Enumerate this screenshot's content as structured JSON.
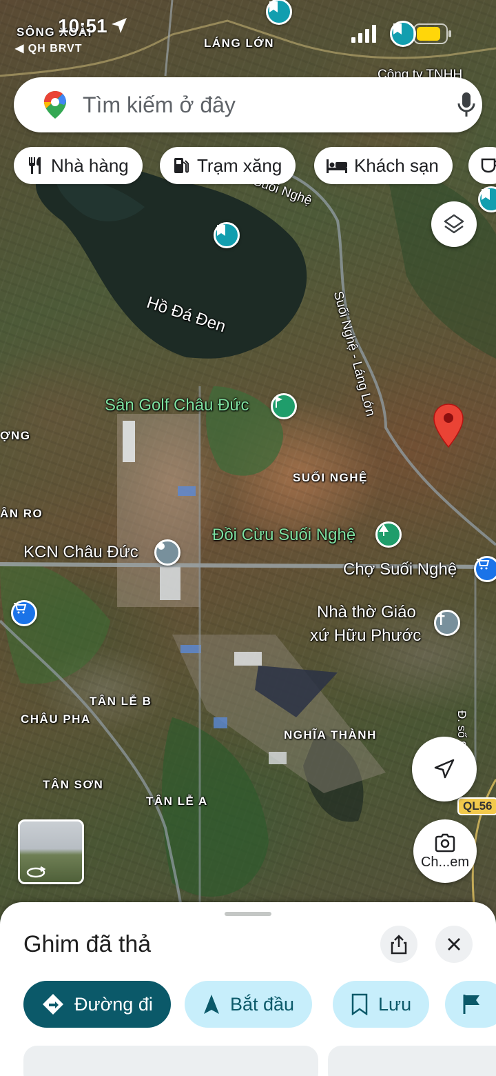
{
  "status_bar": {
    "time": "10:51",
    "back_label": "◀ QH BRVT"
  },
  "search": {
    "placeholder": "Tìm kiếm ở đây"
  },
  "chips": [
    {
      "label": "Nhà hàng",
      "icon": "restaurant-icon"
    },
    {
      "label": "Trạm xăng",
      "icon": "gas-station-icon"
    },
    {
      "label": "Khách sạn",
      "icon": "hotel-icon"
    }
  ],
  "map": {
    "area_labels": {
      "song_xoai": "SÔNG XOÀI",
      "lang_lon": "LÁNG LỚN",
      "cong_ty": "Công ty TNHH",
      "ong": "ỢNG",
      "an_ro": "ÂN RO",
      "suoi_nghe": "SUỐI NGHỆ",
      "tan_le_b": "TÂN LỄ B",
      "chau_pha": "CHÂU PHA",
      "tan_son": "TÂN SƠN",
      "tan_le_a": "TÂN LỄ A",
      "nghia_thanh": "NGHĨA THÀNH"
    },
    "road_labels": {
      "suoi_nghe_lang_lon": "Suối Nghệ - Láng Lớn",
      "suoi_nghe_top": "Suối Nghệ",
      "ql56": "QL56",
      "road_9": "Đ. số 9"
    },
    "pois": {
      "ho_da_den": "Hồ Đá Đen",
      "san_golf": "Sân Golf Châu Đức",
      "doi_cuu": "Đồi Cừu Suối Nghệ",
      "kcn": "KCN Châu Đức",
      "cho": "Chợ Suối Nghệ",
      "nha_tho_1": "Nhà thờ Giáo",
      "nha_tho_2": "xứ Hữu Phước"
    }
  },
  "lens_button": {
    "label": "Ch...em"
  },
  "sheet": {
    "title": "Ghim đã thả",
    "actions": {
      "directions": "Đường đi",
      "start": "Bắt đầu",
      "save": "Lưu"
    }
  },
  "colors": {
    "primary": "#0b5969",
    "secondary_bg": "#c7eefb",
    "pin_red": "#ea4335",
    "poi_teal": "#129eaf",
    "poi_green": "#1f9d6b",
    "shop_blue": "#1a73e8"
  }
}
